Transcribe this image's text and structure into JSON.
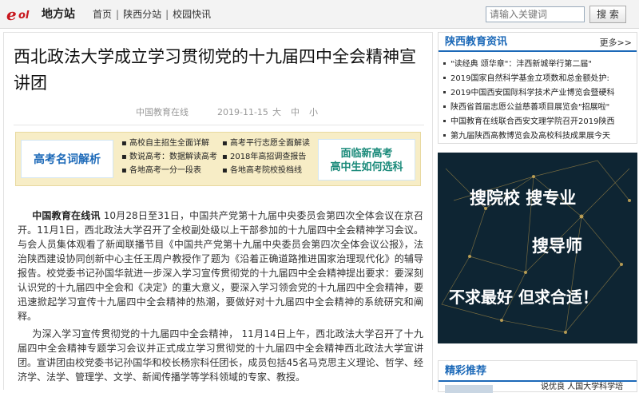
{
  "header": {
    "logo_text": "eol",
    "site_name": "地方站",
    "breadcrumb": [
      "首页",
      "陕西分站",
      "校园快讯"
    ],
    "breadcrumb_sep": "|",
    "search_placeholder": "请输入关键词",
    "search_button": "搜 索"
  },
  "article": {
    "title": "西北政法大学成立学习贯彻党的十九届四中全会精神宣讲团",
    "source": "中国教育在线",
    "date": "2019-11-15",
    "font_sizes": [
      "大",
      "中",
      "小"
    ],
    "banner": {
      "left_text": "高考名词解析",
      "links": [
        "高校自主招生全面详解",
        "高考平行志愿全面解读",
        "数说高考：数据解读高考",
        "2018年高招调查报告",
        "各地高考一分一段表",
        "各地高考院校投档线"
      ],
      "right_text_line1": "面临新高考",
      "right_text_line2": "高中生如何选科"
    },
    "para1_lead": "中国教育在线讯",
    "para1_text": " 10月28日至31日，中国共产党第十九届中央委员会第四次全体会议在京召开。11月1日，西北政法大学召开了全校副处级以上干部参加的十九届四中全会精神学习会议。与会人员集体观看了新闻联播节目《中国共产党第十九届中央委员会第四次全体会议公报》，法治陕西建设协同创新中心主任王周户教授作了题为《沿着正确道路推进国家治理现代化》的辅导报告。校党委书记孙国华就进一步深入学习宣传贯彻党的十九届四中全会精神提出要求：要深刻认识党的十九届四中全会和《决定》的重大意义，要深入学习领会党的十九届四中全会精神，要迅速掀起学习宣传十九届四中全会精神的热潮，要做好对十九届四中全会精神的系统研究和阐释。",
    "para2_text": "为深入学习宣传贯彻党的十九届四中全会精神， 11月14日上午，西北政法大学召开了十九届四中全会精神专题学习会议并正式成立学习贯彻党的十九届四中全会精神西北政法大学宣讲团。宣讲团由校党委书记孙国华和校长杨宗科任团长，成员包括45名马克思主义理论、哲学、经济学、法学、管理学、文学、新闻传播学等学科领域的专家、教授。"
  },
  "sidebar": {
    "news_title": "陕西教育资讯",
    "more": "更多>>",
    "news_items": [
      "\"读经典 颂华章\"：沣西新城举行第二届\"",
      "2019国家自然科学基金立项数和总金额处护:",
      "2019中国西安国际科学技术产业博览会暨硬科",
      "陕西省首届志愿公益慈善项目展览会\"招展啦\"",
      "中国教育在线联合西安文理学院召开2019陕西",
      "第九届陕西高教博览会及高校科技成果展今天"
    ],
    "ad_line1": "搜院校  搜专业",
    "ad_line2": "搜导师",
    "ad_line3": "不求最好  但求合适！",
    "rec_title": "精彩推荐",
    "rec_peek": "说优良 人国大学科学培"
  }
}
